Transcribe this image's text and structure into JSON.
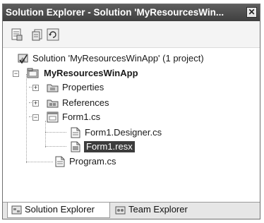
{
  "window": {
    "title": "Solution Explorer - Solution 'MyResourcesWin...",
    "close_glyph": "✕"
  },
  "toolbar": {
    "buttons": [
      {
        "icon": "properties-icon"
      },
      {
        "icon": "show-all-files-icon"
      },
      {
        "icon": "refresh-icon"
      }
    ]
  },
  "tree": {
    "solution": {
      "label": "Solution 'MyResourcesWinApp' (1 project)",
      "icon": "solution-icon"
    },
    "project": {
      "label": "MyResourcesWinApp",
      "icon": "project-icon",
      "expander": "−"
    },
    "items": [
      {
        "label": "Properties",
        "icon": "folder-properties-icon",
        "expander": "+"
      },
      {
        "label": "References",
        "icon": "folder-references-icon",
        "expander": "+"
      },
      {
        "label": "Form1.cs",
        "icon": "form-icon",
        "expander": "−"
      },
      {
        "label": "Form1.Designer.cs",
        "icon": "cs-file-icon"
      },
      {
        "label": "Form1.resx",
        "icon": "resx-file-icon",
        "selected": true
      },
      {
        "label": "Program.cs",
        "icon": "cs-file-icon"
      }
    ]
  },
  "tabs": [
    {
      "label": "Solution Explorer",
      "icon": "solution-explorer-icon",
      "active": true
    },
    {
      "label": "Team Explorer",
      "icon": "team-explorer-icon",
      "active": false
    }
  ]
}
